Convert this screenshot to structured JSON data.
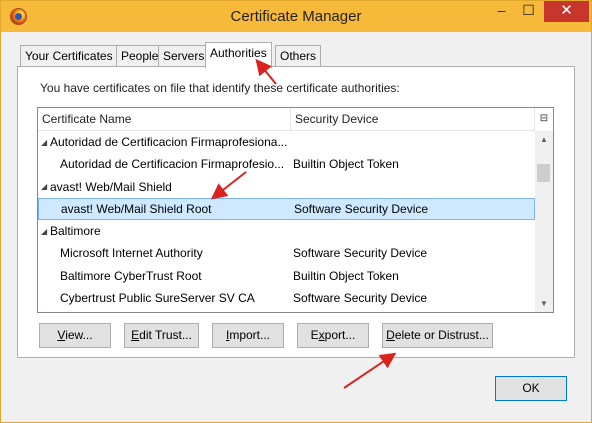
{
  "window": {
    "title": "Certificate Manager",
    "minimize_glyph": "–",
    "maximize_glyph": "☐",
    "close_glyph": "✕"
  },
  "tabs": [
    {
      "label": "Your Certificates",
      "active": false
    },
    {
      "label": "People",
      "active": false
    },
    {
      "label": "Servers",
      "active": false
    },
    {
      "label": "Authorities",
      "active": true
    },
    {
      "label": "Others",
      "active": false
    }
  ],
  "intro_text": "You have certificates on file that identify these certificate authorities:",
  "tree": {
    "columns": [
      "Certificate Name",
      "Security Device"
    ],
    "column_picker_glyph": "⊟",
    "rows": [
      {
        "type": "group",
        "name": "Autoridad de Certificacion Firmaprofesiona...",
        "device": ""
      },
      {
        "type": "leaf",
        "name": "Autoridad de Certificacion Firmaprofesio...",
        "device": "Builtin Object Token"
      },
      {
        "type": "group",
        "name": "avast! Web/Mail Shield",
        "device": ""
      },
      {
        "type": "leaf",
        "name": "avast! Web/Mail Shield Root",
        "device": "Software Security Device",
        "selected": true
      },
      {
        "type": "group",
        "name": "Baltimore",
        "device": ""
      },
      {
        "type": "leaf",
        "name": "Microsoft Internet Authority",
        "device": "Software Security Device"
      },
      {
        "type": "leaf",
        "name": "Baltimore CyberTrust Root",
        "device": "Builtin Object Token"
      },
      {
        "type": "leaf",
        "name": "Cybertrust Public SureServer SV CA",
        "device": "Software Security Device"
      }
    ]
  },
  "buttons": {
    "view": {
      "mnemonic": "V",
      "rest": "iew..."
    },
    "edit_trust": {
      "mnemonic": "E",
      "rest": "dit Trust..."
    },
    "import": {
      "mnemonic": "I",
      "rest": "mport..."
    },
    "export": {
      "mnemonic": "x",
      "pre": "E",
      "rest": "port..."
    },
    "delete": {
      "mnemonic": "D",
      "rest": "elete or Distrust..."
    },
    "ok": "OK"
  },
  "colors": {
    "titlebar": "#f6b93a",
    "close_button": "#c7352b",
    "selection": "#cde8ff",
    "annotation_arrow": "#d8231f"
  }
}
